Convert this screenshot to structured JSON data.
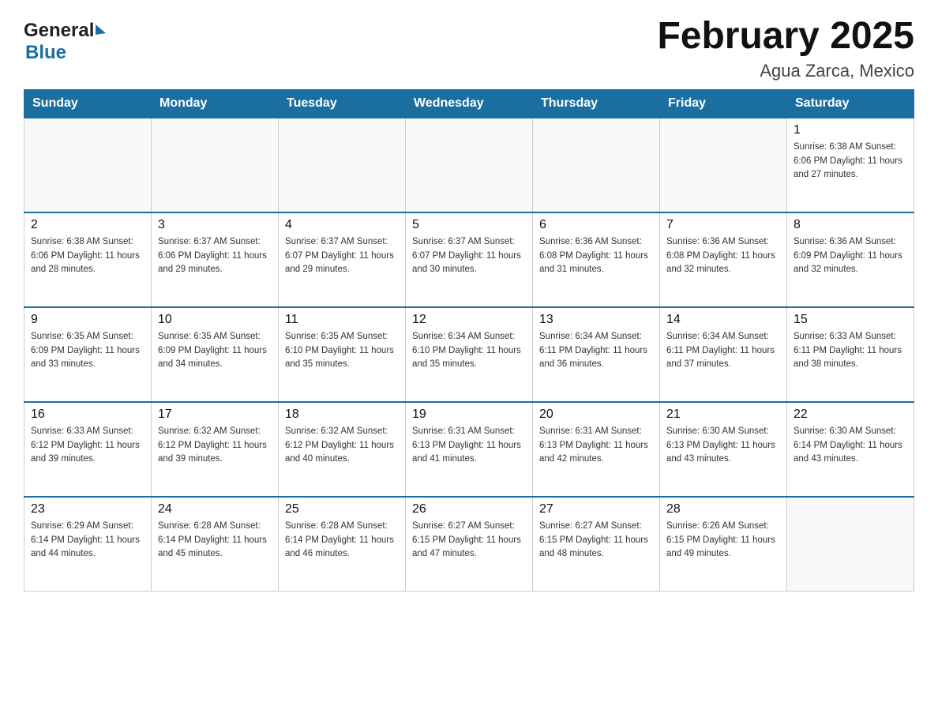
{
  "header": {
    "logo_general": "General",
    "logo_blue": "Blue",
    "title": "February 2025",
    "subtitle": "Agua Zarca, Mexico"
  },
  "calendar": {
    "days_of_week": [
      "Sunday",
      "Monday",
      "Tuesday",
      "Wednesday",
      "Thursday",
      "Friday",
      "Saturday"
    ],
    "weeks": [
      {
        "days": [
          {
            "number": "",
            "info": ""
          },
          {
            "number": "",
            "info": ""
          },
          {
            "number": "",
            "info": ""
          },
          {
            "number": "",
            "info": ""
          },
          {
            "number": "",
            "info": ""
          },
          {
            "number": "",
            "info": ""
          },
          {
            "number": "1",
            "info": "Sunrise: 6:38 AM\nSunset: 6:06 PM\nDaylight: 11 hours\nand 27 minutes."
          }
        ]
      },
      {
        "days": [
          {
            "number": "2",
            "info": "Sunrise: 6:38 AM\nSunset: 6:06 PM\nDaylight: 11 hours\nand 28 minutes."
          },
          {
            "number": "3",
            "info": "Sunrise: 6:37 AM\nSunset: 6:06 PM\nDaylight: 11 hours\nand 29 minutes."
          },
          {
            "number": "4",
            "info": "Sunrise: 6:37 AM\nSunset: 6:07 PM\nDaylight: 11 hours\nand 29 minutes."
          },
          {
            "number": "5",
            "info": "Sunrise: 6:37 AM\nSunset: 6:07 PM\nDaylight: 11 hours\nand 30 minutes."
          },
          {
            "number": "6",
            "info": "Sunrise: 6:36 AM\nSunset: 6:08 PM\nDaylight: 11 hours\nand 31 minutes."
          },
          {
            "number": "7",
            "info": "Sunrise: 6:36 AM\nSunset: 6:08 PM\nDaylight: 11 hours\nand 32 minutes."
          },
          {
            "number": "8",
            "info": "Sunrise: 6:36 AM\nSunset: 6:09 PM\nDaylight: 11 hours\nand 32 minutes."
          }
        ]
      },
      {
        "days": [
          {
            "number": "9",
            "info": "Sunrise: 6:35 AM\nSunset: 6:09 PM\nDaylight: 11 hours\nand 33 minutes."
          },
          {
            "number": "10",
            "info": "Sunrise: 6:35 AM\nSunset: 6:09 PM\nDaylight: 11 hours\nand 34 minutes."
          },
          {
            "number": "11",
            "info": "Sunrise: 6:35 AM\nSunset: 6:10 PM\nDaylight: 11 hours\nand 35 minutes."
          },
          {
            "number": "12",
            "info": "Sunrise: 6:34 AM\nSunset: 6:10 PM\nDaylight: 11 hours\nand 35 minutes."
          },
          {
            "number": "13",
            "info": "Sunrise: 6:34 AM\nSunset: 6:11 PM\nDaylight: 11 hours\nand 36 minutes."
          },
          {
            "number": "14",
            "info": "Sunrise: 6:34 AM\nSunset: 6:11 PM\nDaylight: 11 hours\nand 37 minutes."
          },
          {
            "number": "15",
            "info": "Sunrise: 6:33 AM\nSunset: 6:11 PM\nDaylight: 11 hours\nand 38 minutes."
          }
        ]
      },
      {
        "days": [
          {
            "number": "16",
            "info": "Sunrise: 6:33 AM\nSunset: 6:12 PM\nDaylight: 11 hours\nand 39 minutes."
          },
          {
            "number": "17",
            "info": "Sunrise: 6:32 AM\nSunset: 6:12 PM\nDaylight: 11 hours\nand 39 minutes."
          },
          {
            "number": "18",
            "info": "Sunrise: 6:32 AM\nSunset: 6:12 PM\nDaylight: 11 hours\nand 40 minutes."
          },
          {
            "number": "19",
            "info": "Sunrise: 6:31 AM\nSunset: 6:13 PM\nDaylight: 11 hours\nand 41 minutes."
          },
          {
            "number": "20",
            "info": "Sunrise: 6:31 AM\nSunset: 6:13 PM\nDaylight: 11 hours\nand 42 minutes."
          },
          {
            "number": "21",
            "info": "Sunrise: 6:30 AM\nSunset: 6:13 PM\nDaylight: 11 hours\nand 43 minutes."
          },
          {
            "number": "22",
            "info": "Sunrise: 6:30 AM\nSunset: 6:14 PM\nDaylight: 11 hours\nand 43 minutes."
          }
        ]
      },
      {
        "days": [
          {
            "number": "23",
            "info": "Sunrise: 6:29 AM\nSunset: 6:14 PM\nDaylight: 11 hours\nand 44 minutes."
          },
          {
            "number": "24",
            "info": "Sunrise: 6:28 AM\nSunset: 6:14 PM\nDaylight: 11 hours\nand 45 minutes."
          },
          {
            "number": "25",
            "info": "Sunrise: 6:28 AM\nSunset: 6:14 PM\nDaylight: 11 hours\nand 46 minutes."
          },
          {
            "number": "26",
            "info": "Sunrise: 6:27 AM\nSunset: 6:15 PM\nDaylight: 11 hours\nand 47 minutes."
          },
          {
            "number": "27",
            "info": "Sunrise: 6:27 AM\nSunset: 6:15 PM\nDaylight: 11 hours\nand 48 minutes."
          },
          {
            "number": "28",
            "info": "Sunrise: 6:26 AM\nSunset: 6:15 PM\nDaylight: 11 hours\nand 49 minutes."
          },
          {
            "number": "",
            "info": ""
          }
        ]
      }
    ]
  }
}
